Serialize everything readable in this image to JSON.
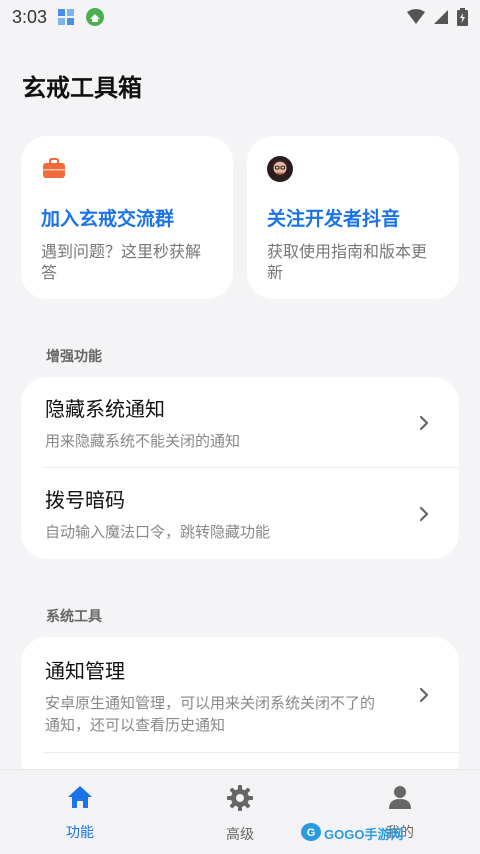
{
  "status_bar": {
    "time": "3:03"
  },
  "header": {
    "title": "玄戒工具箱"
  },
  "top_cards": [
    {
      "icon": "briefcase-icon",
      "title": "加入玄戒交流群",
      "subtitle": "遇到问题？这里秒获解答"
    },
    {
      "icon": "developer-avatar",
      "title": "关注开发者抖音",
      "subtitle": "获取使用指南和版本更新"
    }
  ],
  "sections": [
    {
      "label": "增强功能",
      "items": [
        {
          "title": "隐藏系统通知",
          "subtitle": "用来隐藏系统不能关闭的通知"
        },
        {
          "title": "拨号暗码",
          "subtitle": "自动输入魔法口令，跳转隐藏功能"
        }
      ]
    },
    {
      "label": "系统工具",
      "items": [
        {
          "title": "通知管理",
          "subtitle": "安卓原生通知管理，可以用来关闭系统关闭不了的通知，还可以查看历史通知"
        }
      ]
    }
  ],
  "bottom_nav": [
    {
      "icon": "home-icon",
      "label": "功能",
      "active": true
    },
    {
      "icon": "gear-icon",
      "label": "高级",
      "active": false
    },
    {
      "icon": "person-icon",
      "label": "我的",
      "active": false
    }
  ],
  "watermark": {
    "text": "GOGO手游网"
  },
  "colors": {
    "accent": "#1a73e8",
    "background": "#f4f4f6",
    "card": "#ffffff",
    "briefcase": "#f06a3a"
  }
}
